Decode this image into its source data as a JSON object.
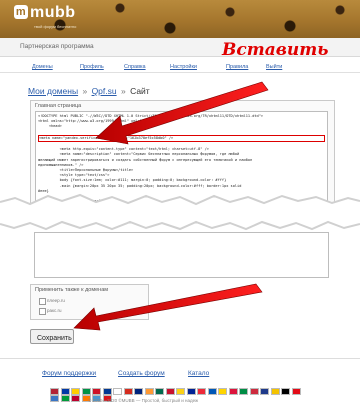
{
  "header": {
    "logo": "mubb",
    "slogan": "твой форум бесплатно"
  },
  "program_label": "Партнерская программа",
  "annotation": "Вставить",
  "nav": [
    "Домены",
    "Профиль",
    "Справка",
    "Настройки",
    "Правила",
    "Выйти"
  ],
  "breadcrumb": {
    "root": "Мои домены",
    "sep1": "»",
    "domain": "Qpf.su",
    "sep2": "»",
    "current": "Сайт"
  },
  "panel_title": "Главная страница",
  "code_lines": [
    "<!DOCTYPE html PUBLIC \"-//W3C//DTD XHTML 1.0 Strict//EN\" \"http://www.w3.org/TR/xhtml11/DTD/xhtml11.dtd\">",
    "<html xmlns=\"http://www.w3.org/1999/xhtml\" xml:lang=\"ru\">",
    "     <head>",
    "",
    "<meta name=\"yandex-verification\" content=\"162b370ef5c58db0\" />",
    "",
    "          <meta http-equiv=\"content-type\" content=\"text/html; charset=utf-8\" />",
    "          <meta name=\"description\" content=\"Сервис бесплатных персональных форумов, где любой",
    "желающий может зарегистрироваться и создать собственный форум с интересующей его тематикой и наибол",
    "единомышленников.\" />",
    "          <title>Персональные форумы</title>",
    "          <style type=\"text/css\">",
    "          body {font-size:1em; color:#111; margin:0; padding:0; background-color: #fff}",
    "          .main {margin:20px 35 20px 35; padding:20px; background-color:#fff; border:1px solid",
    "#eee}",
    "",
    "          .small {font-size:0.6em}"
  ],
  "apply": {
    "title": "Применить также к доменам",
    "items": [
      "плеер.ru",
      "ракс.ru"
    ]
  },
  "save_label": "Сохранить",
  "footer": {
    "links": [
      "Форум поддержки",
      "Создать форум",
      "Катало"
    ],
    "copyright": "© 2005—2020 ©MUBB — Простой, быстрый и надеж"
  },
  "colors": {
    "accent": "#2a5cab",
    "annotation_red": "#e00000",
    "header_brown": "#a5762d"
  },
  "flag_colors": [
    "#b22234",
    "#0039a6",
    "#ffce00",
    "#009246",
    "#ce1126",
    "#003893",
    "#ffffff",
    "#d52b1e",
    "#00247d",
    "#ff9933",
    "#006a4e",
    "#c8102e",
    "#fcd116",
    "#002395",
    "#ed2939",
    "#0057b7",
    "#ffd500",
    "#dc143c",
    "#008c45",
    "#cd2a3e",
    "#1e3a8a",
    "#f4c300",
    "#000000",
    "#e30a17",
    "#3a75c4",
    "#009b3a",
    "#bc002d",
    "#ff7900",
    "#4997d0",
    "#d7141a"
  ]
}
